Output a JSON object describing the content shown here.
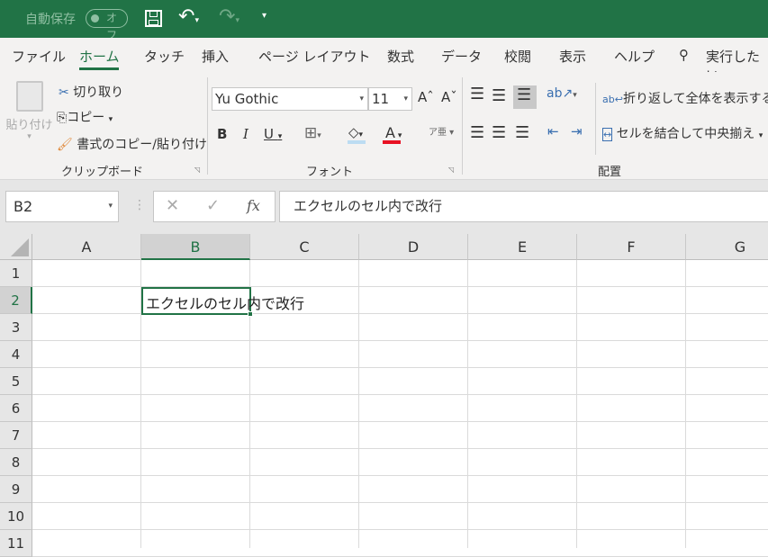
{
  "titlebar": {
    "autosave_label": "自動保存",
    "autosave_state": "オフ",
    "icons": [
      "save-icon",
      "undo-icon",
      "redo-icon",
      "customize-icon"
    ]
  },
  "tabs": [
    {
      "label": "ファイル"
    },
    {
      "label": "ホーム",
      "active": true
    },
    {
      "label": "タッチ"
    },
    {
      "label": "挿入"
    },
    {
      "label": "ページ レイアウト"
    },
    {
      "label": "数式"
    },
    {
      "label": "データ"
    },
    {
      "label": "校閲"
    },
    {
      "label": "表示"
    },
    {
      "label": "ヘルプ"
    }
  ],
  "tell_me": "実行したい",
  "clipboard": {
    "paste": "貼り付け",
    "cut": "切り取り",
    "copy": "コピー",
    "format_painter": "書式のコピー/貼り付け",
    "group": "クリップボード"
  },
  "font": {
    "name": "Yu Gothic",
    "size": "11",
    "bold": "B",
    "italic": "I",
    "underline": "U",
    "group": "フォント",
    "font_color": "#e81123"
  },
  "alignment": {
    "wrap": "折り返して全体を表示する",
    "merge": "セルを結合して中央揃え",
    "group": "配置"
  },
  "formula_bar": {
    "name_box": "B2",
    "fx": "fx",
    "content": "エクセルのセル内で改行"
  },
  "columns": [
    "A",
    "B",
    "C",
    "D",
    "E",
    "F",
    "G"
  ],
  "rows": [
    "1",
    "2",
    "3",
    "4",
    "5",
    "6",
    "7",
    "8",
    "9",
    "10",
    "11"
  ],
  "cells": {
    "B2": "エクセルのセル内で改行"
  },
  "selected": "B2",
  "accent": "#217346"
}
